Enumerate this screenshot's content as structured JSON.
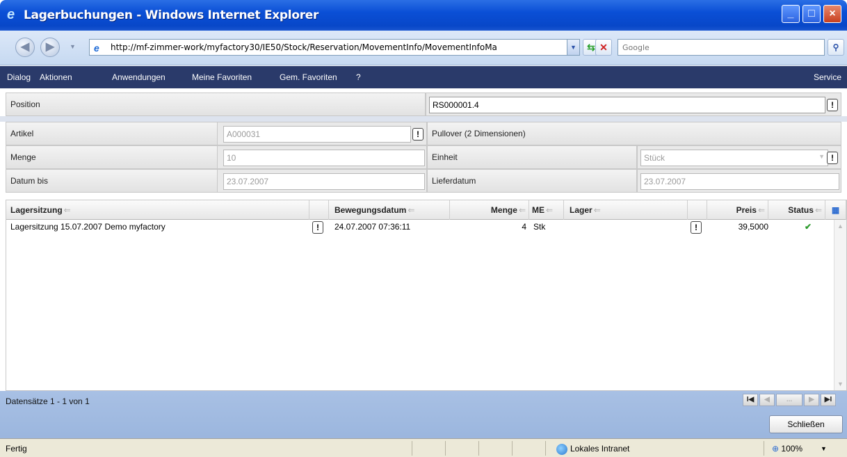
{
  "window": {
    "title": "Lagerbuchungen - Windows Internet Explorer",
    "buttons": {
      "minimize": "_",
      "maximize": "□",
      "close": "×"
    }
  },
  "browser": {
    "url": "http://mf-zimmer-work/myfactory30/IE50/Stock/Reservation/MovementInfo/MovementInfoMa",
    "search_placeholder": "Google"
  },
  "menu": {
    "items": [
      "Dialog",
      "Aktionen",
      "Anwendungen",
      "Meine Favoriten",
      "Gem. Favoriten",
      "?"
    ],
    "service": "Service"
  },
  "form": {
    "position_label": "Position",
    "position_value": "RS000001.4",
    "artikel_label": "Artikel",
    "artikel_value": "A000031",
    "artikel_desc": "Pullover (2 Dimensionen)",
    "menge_label": "Menge",
    "menge_value": "10",
    "einheit_label": "Einheit",
    "einheit_value": "Stück",
    "datum_label": "Datum bis",
    "datum_value": "23.07.2007",
    "lieferdatum_label": "Lieferdatum",
    "lieferdatum_value": "23.07.2007"
  },
  "grid": {
    "columns": {
      "lagersitzung": "Lagersitzung",
      "bewegungsdatum": "Bewegungsdatum",
      "menge": "Menge",
      "me": "ME",
      "lager": "Lager",
      "preis": "Preis",
      "status": "Status"
    },
    "rows": [
      {
        "lagersitzung": "Lagersitzung 15.07.2007 Demo myfactory",
        "bewegungsdatum": "24.07.2007 07:36:11",
        "menge": "4",
        "me": "Stk",
        "lager": "",
        "preis": "39,5000",
        "status": "✔"
      }
    ]
  },
  "footer": {
    "record_count": "Datensätze 1 - 1 von 1",
    "pager": {
      "first": "I◀",
      "prev": "◀",
      "more": "...",
      "next": "▶",
      "last": "▶I"
    },
    "close_label": "Schließen"
  },
  "statusbar": {
    "status": "Fertig",
    "zone": "Lokales Intranet",
    "zoom": "100%"
  }
}
